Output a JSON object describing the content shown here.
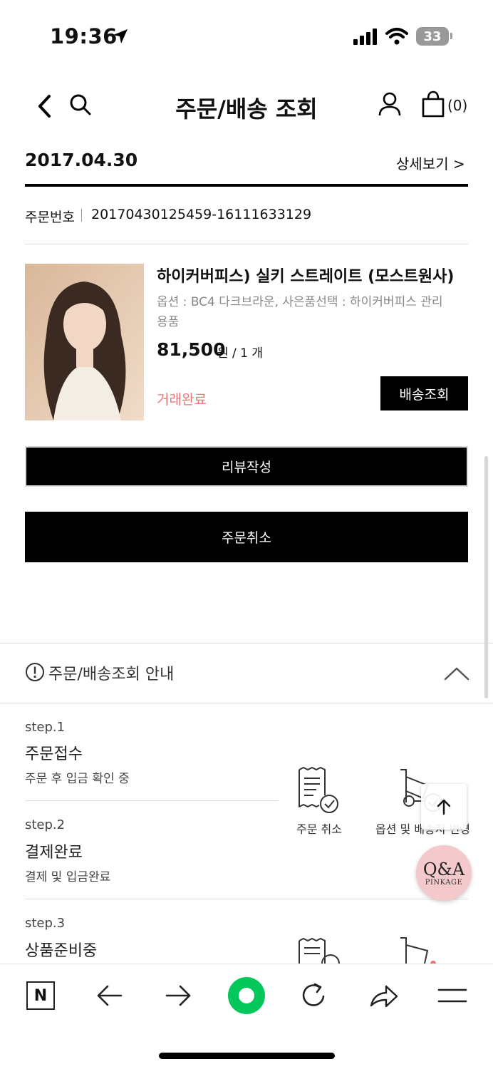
{
  "status_bar": {
    "time": "19:36",
    "battery": "33"
  },
  "header": {
    "title": "주문/배송 조회",
    "cart_count": "(0)"
  },
  "order": {
    "date": "2017.04.30",
    "detail_link": "상세보기 >",
    "order_no_label": "주문번호",
    "order_no": "20170430125459-16111633129"
  },
  "product": {
    "name": "하이커버피스) 실키 스트레이트 (모스트원사)",
    "options_line1": "옵션 : BC4 다크브라운, 사은품선택 : 하이커버피스 관리",
    "options_line2": "용품",
    "price": "81,500",
    "price_unit": "원 / 1 개",
    "status": "거래완료",
    "ship_button": "배송조회"
  },
  "actions": {
    "review": "리뷰작성",
    "cancel": "주문취소"
  },
  "guide": {
    "title": "주문/배송조회 안내",
    "steps": [
      {
        "label": "step.1",
        "title": "주문접수",
        "desc": "주문 후 입금 확인 중"
      },
      {
        "label": "step.2",
        "title": "결제완료",
        "desc": "결제 및 입금완료"
      },
      {
        "label": "step.3",
        "title": "상품준비중",
        "desc": ""
      }
    ],
    "icons": [
      {
        "name": "receipt-check-icon",
        "label": "주문 취소"
      },
      {
        "name": "hand-truck-icon",
        "label": "옵션 및 배송지 변경"
      }
    ]
  },
  "floating": {
    "qa_text": "Q&A",
    "qa_brand": "PINKAGE"
  },
  "colors": {
    "accent": "#000000",
    "status": "#e8777a",
    "qa_badge": "#f4c9cc",
    "browser_home": "#03c75a"
  }
}
